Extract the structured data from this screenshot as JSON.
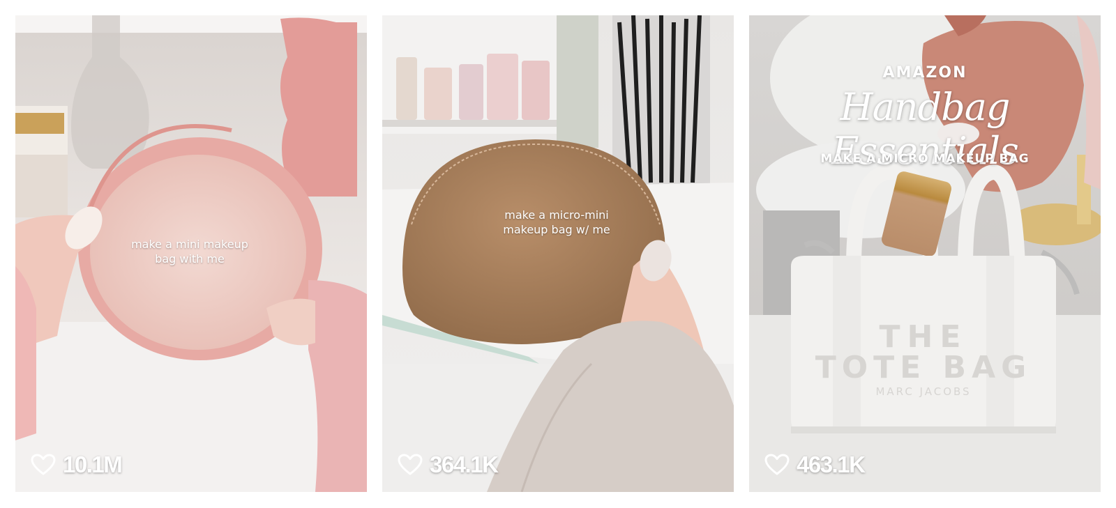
{
  "cards": [
    {
      "caption_line1": "make a mini makeup",
      "caption_line2": "bag with me",
      "likes": "10.1M",
      "accent": "#e9a9a6"
    },
    {
      "caption_line1": "make a micro-mini",
      "caption_line2": "makeup bag w/ me",
      "likes": "364.1K",
      "accent": "#a97f5a"
    },
    {
      "title_top": "AMAZON",
      "title_script": "Handbag Essentials",
      "title_sub": "MAKE A MICRO MAKEUP BAG",
      "bag_text_line1": "THE",
      "bag_text_line2": "TOTE BAG",
      "bag_text_line3": "MARC JACOBS",
      "likes": "463.1K",
      "accent": "#f2f1ef"
    }
  ],
  "icons": {
    "like": "heart-outline-icon"
  }
}
